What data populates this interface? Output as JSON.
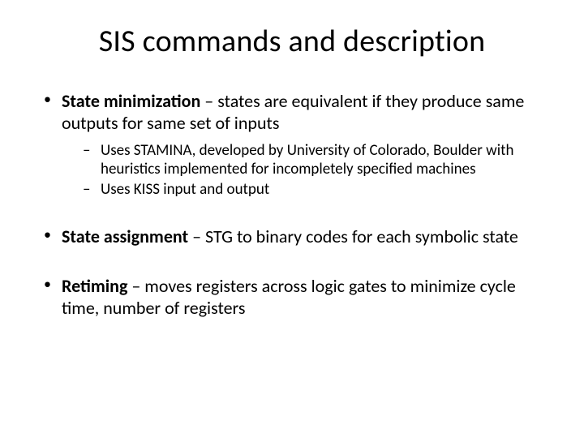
{
  "title": "SIS commands and description",
  "bullets": {
    "b1": {
      "bold": "State minimization",
      "rest": " – states are equivalent if they produce same outputs for same set of inputs"
    },
    "b1_subs": {
      "s1": "Uses STAMINA, developed by University of Colorado, Boulder with heuristics implemented for incompletely specified machines",
      "s2": "Uses KISS input and output"
    },
    "b2": {
      "bold": "State assignment",
      "rest": " – STG to binary codes for each symbolic state"
    },
    "b3": {
      "bold": "Retiming",
      "rest": " – moves registers across logic gates to minimize cycle time, number of registers"
    }
  }
}
